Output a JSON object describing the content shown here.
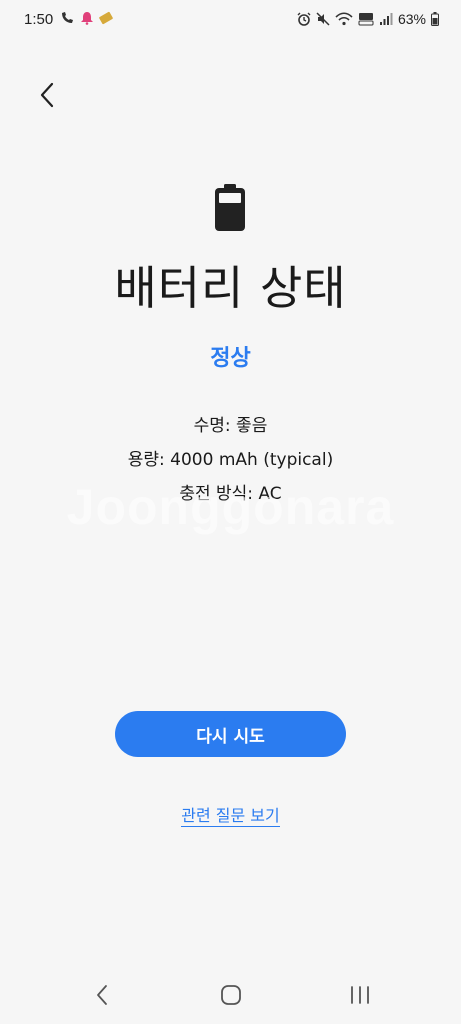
{
  "status_bar": {
    "time": "1:50",
    "battery_percent": "63%"
  },
  "main": {
    "title": "배터리 상태",
    "status": "정상",
    "info": [
      "수명: 좋음",
      "용량: 4000 mAh (typical)",
      "충전 방식: AC"
    ],
    "watermark": "Joonggonara",
    "retry_button": "다시 시도",
    "faq_link": "관련 질문 보기"
  },
  "colors": {
    "accent": "#2b7cf0",
    "background": "#f6f6f6"
  }
}
